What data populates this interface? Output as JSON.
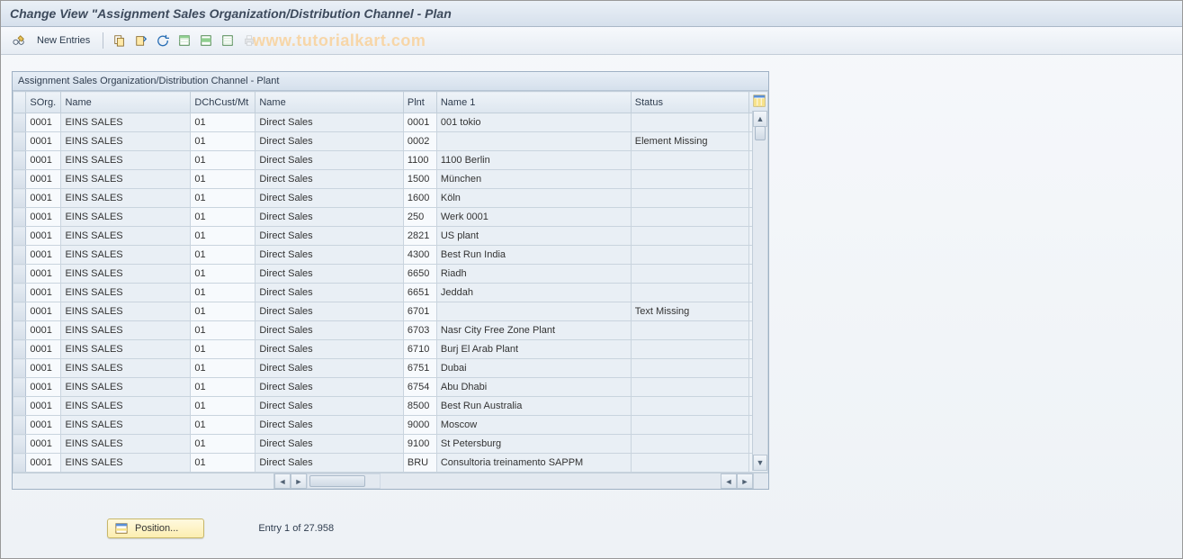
{
  "title": "Change View \"Assignment Sales Organization/Distribution Channel - Plan",
  "toolbar": {
    "new_entries": "New Entries"
  },
  "watermark": "www.tutorialkart.com",
  "panel_title": "Assignment Sales Organization/Distribution Channel - Plant",
  "columns": {
    "sorg": "SOrg.",
    "name": "Name",
    "dch": "DChCust/Mt",
    "name2": "Name",
    "plnt": "Plnt",
    "name3": "Name 1",
    "status": "Status"
  },
  "rows": [
    {
      "sorg": "0001",
      "name": "EINS SALES",
      "dch": "01",
      "name2": "Direct Sales",
      "plnt": "0001",
      "name3": "001 tokio",
      "status": ""
    },
    {
      "sorg": "0001",
      "name": "EINS SALES",
      "dch": "01",
      "name2": "Direct Sales",
      "plnt": "0002",
      "name3": "",
      "status": "Element Missing"
    },
    {
      "sorg": "0001",
      "name": "EINS SALES",
      "dch": "01",
      "name2": "Direct Sales",
      "plnt": "1100",
      "name3": "1100 Berlin",
      "status": ""
    },
    {
      "sorg": "0001",
      "name": "EINS SALES",
      "dch": "01",
      "name2": "Direct Sales",
      "plnt": "1500",
      "name3": "München",
      "status": ""
    },
    {
      "sorg": "0001",
      "name": "EINS SALES",
      "dch": "01",
      "name2": "Direct Sales",
      "plnt": "1600",
      "name3": "Köln",
      "status": ""
    },
    {
      "sorg": "0001",
      "name": "EINS SALES",
      "dch": "01",
      "name2": "Direct Sales",
      "plnt": "250",
      "name3": "Werk 0001",
      "status": ""
    },
    {
      "sorg": "0001",
      "name": "EINS SALES",
      "dch": "01",
      "name2": "Direct Sales",
      "plnt": "2821",
      "name3": "US plant",
      "status": ""
    },
    {
      "sorg": "0001",
      "name": "EINS SALES",
      "dch": "01",
      "name2": "Direct Sales",
      "plnt": "4300",
      "name3": "Best Run India",
      "status": ""
    },
    {
      "sorg": "0001",
      "name": "EINS SALES",
      "dch": "01",
      "name2": "Direct Sales",
      "plnt": "6650",
      "name3": "Riadh",
      "status": ""
    },
    {
      "sorg": "0001",
      "name": "EINS SALES",
      "dch": "01",
      "name2": "Direct Sales",
      "plnt": "6651",
      "name3": "Jeddah",
      "status": ""
    },
    {
      "sorg": "0001",
      "name": "EINS SALES",
      "dch": "01",
      "name2": "Direct Sales",
      "plnt": "6701",
      "name3": "",
      "status": "Text Missing"
    },
    {
      "sorg": "0001",
      "name": "EINS SALES",
      "dch": "01",
      "name2": "Direct Sales",
      "plnt": "6703",
      "name3": "Nasr City Free Zone Plant",
      "status": ""
    },
    {
      "sorg": "0001",
      "name": "EINS SALES",
      "dch": "01",
      "name2": "Direct Sales",
      "plnt": "6710",
      "name3": "Burj El Arab Plant",
      "status": ""
    },
    {
      "sorg": "0001",
      "name": "EINS SALES",
      "dch": "01",
      "name2": "Direct Sales",
      "plnt": "6751",
      "name3": "Dubai",
      "status": ""
    },
    {
      "sorg": "0001",
      "name": "EINS SALES",
      "dch": "01",
      "name2": "Direct Sales",
      "plnt": "6754",
      "name3": "Abu Dhabi",
      "status": ""
    },
    {
      "sorg": "0001",
      "name": "EINS SALES",
      "dch": "01",
      "name2": "Direct Sales",
      "plnt": "8500",
      "name3": "Best Run Australia",
      "status": ""
    },
    {
      "sorg": "0001",
      "name": "EINS SALES",
      "dch": "01",
      "name2": "Direct Sales",
      "plnt": "9000",
      "name3": "Moscow",
      "status": ""
    },
    {
      "sorg": "0001",
      "name": "EINS SALES",
      "dch": "01",
      "name2": "Direct Sales",
      "plnt": "9100",
      "name3": "St Petersburg",
      "status": ""
    },
    {
      "sorg": "0001",
      "name": "EINS SALES",
      "dch": "01",
      "name2": "Direct Sales",
      "plnt": "BRU",
      "name3": "Consultoria treinamento SAPPM",
      "status": ""
    }
  ],
  "footer": {
    "position_btn": "Position...",
    "entry_info": "Entry 1 of 27.958"
  }
}
